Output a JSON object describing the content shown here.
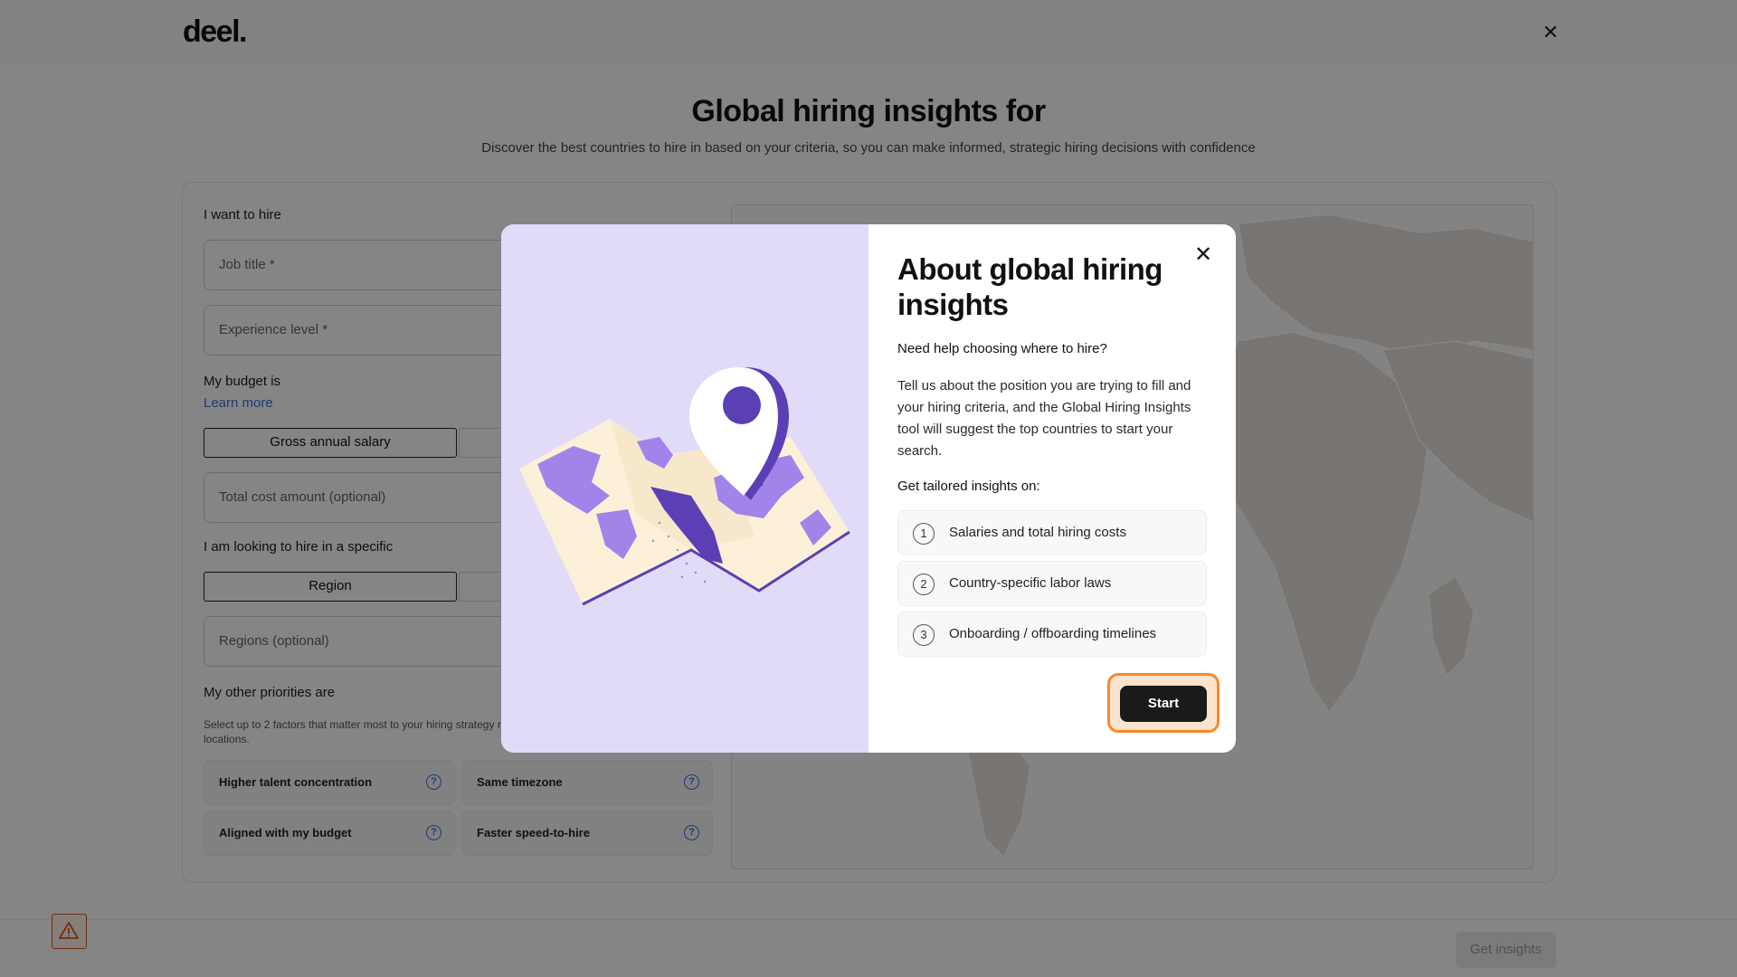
{
  "header": {
    "logo": "deel.",
    "close_icon": "close-icon"
  },
  "page": {
    "title": "Global hiring insights for",
    "subtitle": "Discover the best countries to hire in based on your criteria, so you can make informed, strategic hiring decisions with confidence"
  },
  "form": {
    "hire_label": "I want to hire",
    "job_title_placeholder": "Job title *",
    "experience_placeholder": "Experience level *",
    "budget_label": "My budget is",
    "learn_more": "Learn more",
    "salary_toggle": "Gross annual salary",
    "cost_placeholder": "Total cost amount (optional)",
    "specific_label": "I am looking to hire in a specific",
    "region_toggle": "Region",
    "regions_placeholder": "Regions (optional)",
    "priorities_label": "My other priorities are",
    "priorities_help": "Select up to 2 factors that matter most to your hiring strategy recommendations for the best hiring locations.",
    "chips": [
      "Higher talent concentration",
      "Same timezone",
      "Aligned with my budget",
      "Faster speed-to-hire"
    ]
  },
  "footer": {
    "get_insights": "Get insights",
    "warning_icon": "warning-icon"
  },
  "modal": {
    "title": "About global hiring insights",
    "question": "Need help choosing where to hire?",
    "paragraph": "Tell us about the position you are trying to fill and your hiring criteria, and the Global Hiring Insights tool will suggest the top countries to start your search.",
    "tailored": "Get tailored insights on:",
    "steps": [
      {
        "num": "1",
        "text": "Salaries and total hiring costs"
      },
      {
        "num": "2",
        "text": "Country-specific labor laws"
      },
      {
        "num": "3",
        "text": "Onboarding / offboarding timelines"
      }
    ],
    "start": "Start"
  },
  "colors": {
    "accent_orange": "#f58a2a",
    "illustration_bg": "#e2dbf8",
    "purple": "#5b3fb5",
    "link_blue": "#3a6fd8"
  }
}
